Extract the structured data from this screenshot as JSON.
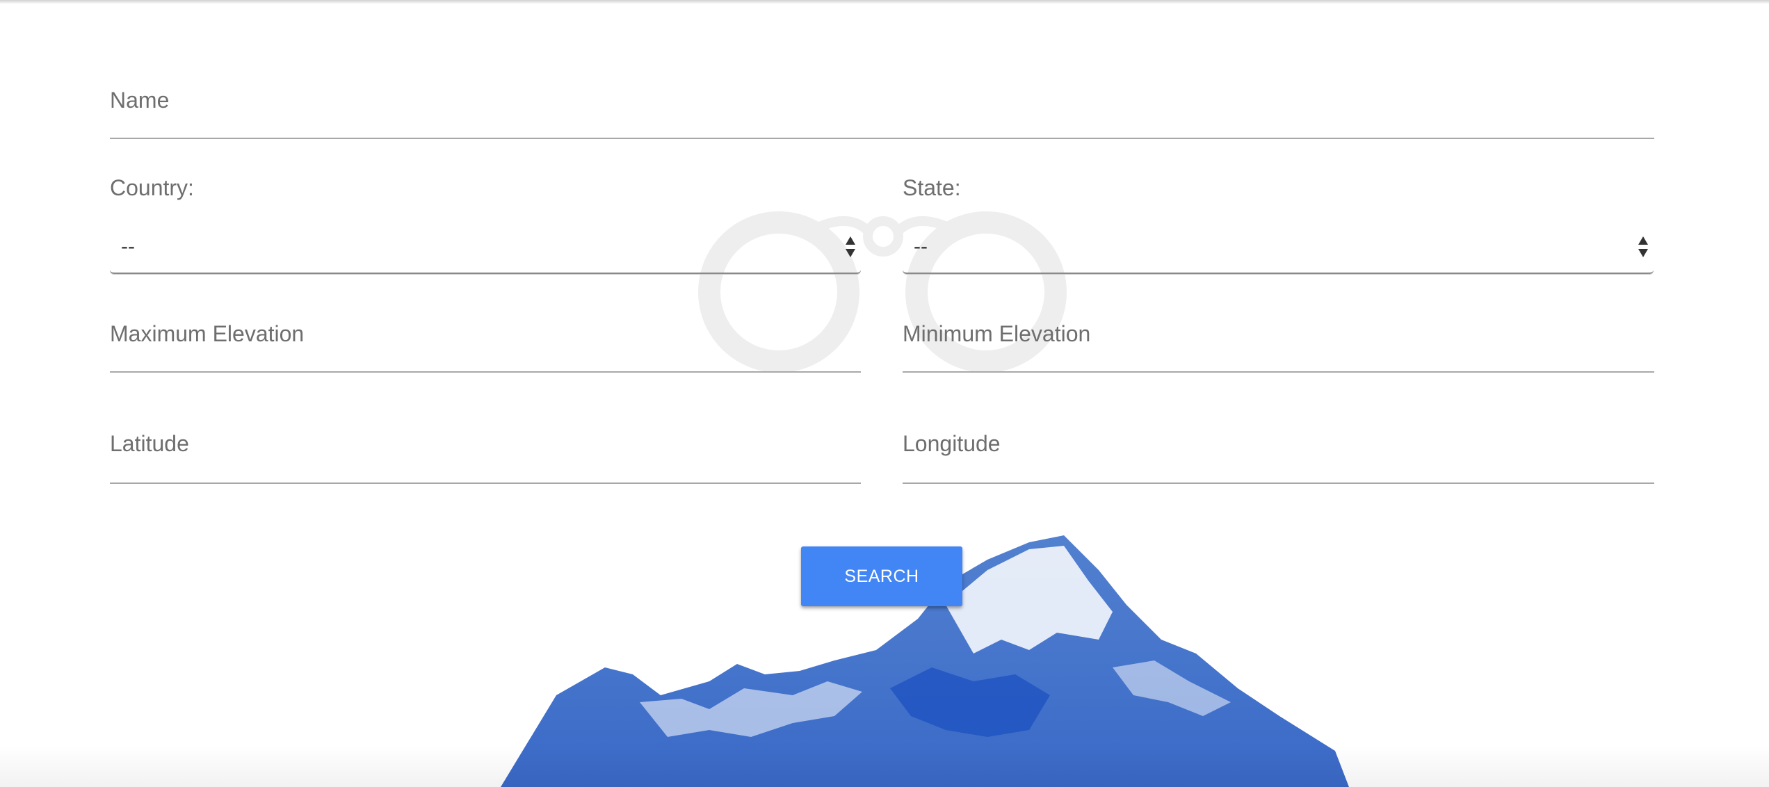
{
  "form": {
    "name": {
      "label": "Name",
      "value": ""
    },
    "country": {
      "label": "Country:",
      "selected": "--"
    },
    "state": {
      "label": "State:",
      "selected": "--"
    },
    "max_elevation": {
      "label": "Maximum Elevation",
      "value": ""
    },
    "min_elevation": {
      "label": "Minimum Elevation",
      "value": ""
    },
    "latitude": {
      "label": "Latitude",
      "value": ""
    },
    "longitude": {
      "label": "Longitude",
      "value": ""
    }
  },
  "search_button": {
    "label": "SEARCH"
  },
  "colors": {
    "accent": "#4285f4",
    "mountain_blue": "#2f64c2",
    "watermark": "#efefef",
    "label": "#6e6e6e"
  },
  "icons": {
    "watermark": "binoculars-icon",
    "select_arrows": "updown-arrows-icon",
    "background": "mountain-illustration"
  }
}
